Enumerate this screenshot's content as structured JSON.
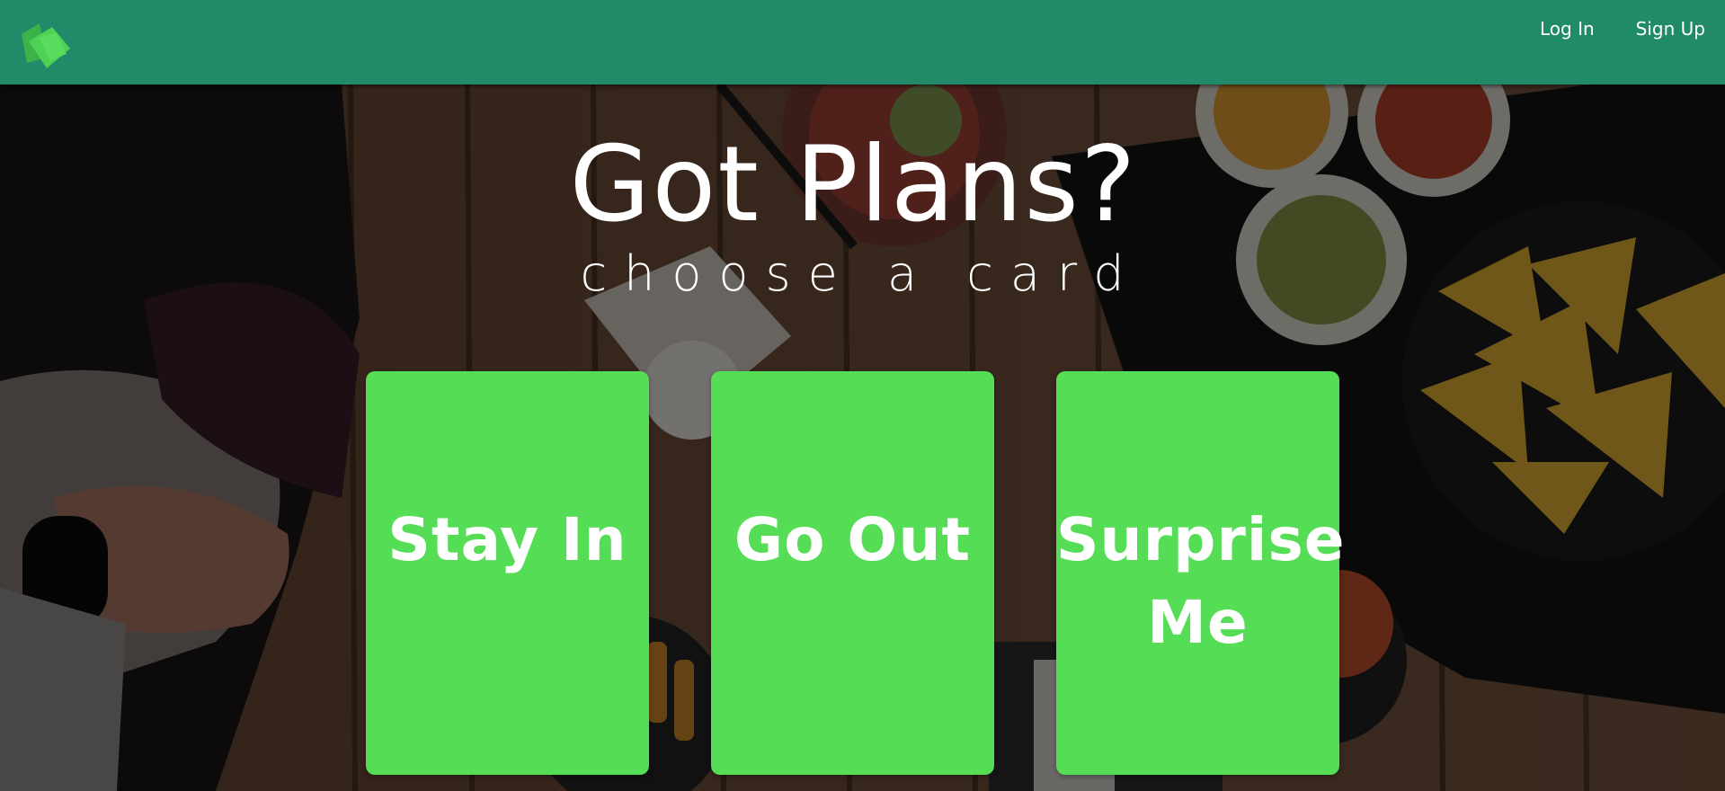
{
  "navbar": {
    "color": "#218a68",
    "logo_icon": "green-cards-logo-icon",
    "links": [
      {
        "label": "Log In"
      },
      {
        "label": "Sign Up"
      }
    ]
  },
  "hero": {
    "title": "Got Plans?",
    "subtitle": "choose a card"
  },
  "cards": {
    "color": "#55dd55",
    "items": [
      {
        "label": "Stay In"
      },
      {
        "label": "Go Out"
      },
      {
        "label": "Surprise Me"
      }
    ]
  }
}
